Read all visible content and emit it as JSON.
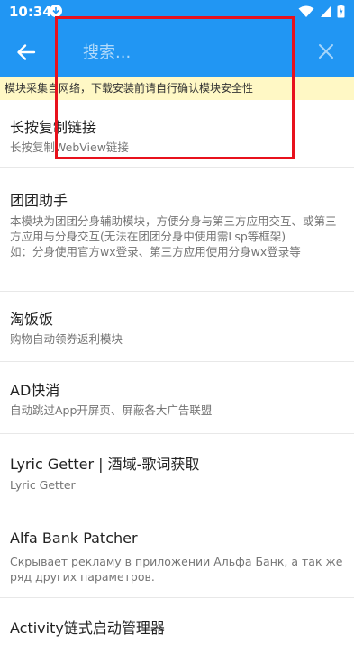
{
  "status_bar": {
    "time": "10:34"
  },
  "search": {
    "placeholder": "搜索..."
  },
  "notice": "模块采集自网络，下载安装前请自行确认模块安全性",
  "modules": [
    {
      "title": "长按复制链接",
      "desc": "长按复制WebView链接"
    },
    {
      "title": "团团助手",
      "desc": "本模块为团团分身辅助模块，方便分身与第三方应用交互、或第三方应用与分身交互(无法在团团分身中使用需Lsp等框架)\n如：分身使用官方wx登录、第三方应用使用分身wx登录等"
    },
    {
      "title": "淘饭饭",
      "desc": "购物自动领券返利模块"
    },
    {
      "title": "AD快消",
      "desc": "自动跳过App开屏页、屏蔽各大广告联盟"
    },
    {
      "title": "Lyric Getter | 酒域-歌词获取",
      "desc": "Lyric Getter"
    },
    {
      "title": "Alfa Bank Patcher",
      "desc": "Скрывает рекламу в приложении Альфа Банк, а так же ряд других параметров."
    },
    {
      "title": "Activity链式启动管理器",
      "desc": ""
    }
  ],
  "colors": {
    "primary": "#2196F3",
    "notice_bg": "#FFF8C5",
    "highlight": "#E8111C"
  }
}
